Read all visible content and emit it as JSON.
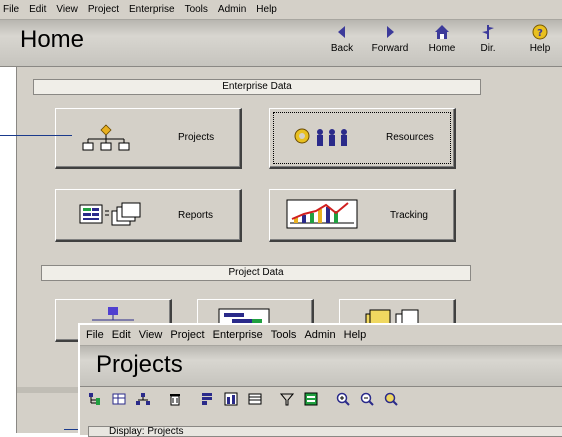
{
  "main_window": {
    "menu": [
      "File",
      "Edit",
      "View",
      "Project",
      "Enterprise",
      "Tools",
      "Admin",
      "Help"
    ],
    "title": "Home",
    "nav": [
      {
        "label": "Back",
        "icon": "back-arrow-icon"
      },
      {
        "label": "Forward",
        "icon": "forward-arrow-icon"
      },
      {
        "label": "Home",
        "icon": "home-icon"
      },
      {
        "label": "Dir.",
        "icon": "directory-icon"
      },
      {
        "label": "Help",
        "icon": "help-icon"
      }
    ],
    "enterprise_section": {
      "heading": "Enterprise Data",
      "tiles": [
        {
          "label": "Projects",
          "icon": "org-chart-icon"
        },
        {
          "label": "Resources",
          "icon": "people-icon"
        },
        {
          "label": "Reports",
          "icon": "report-pages-icon"
        },
        {
          "label": "Tracking",
          "icon": "tracking-chart-icon"
        }
      ]
    },
    "project_section": {
      "heading": "Project Data",
      "tiles": [
        {
          "icon": "wbs-icon"
        },
        {
          "icon": "gantt-icon"
        },
        {
          "icon": "documents-icon"
        }
      ]
    }
  },
  "overlay_window": {
    "menu": [
      "File",
      "Edit",
      "View",
      "Project",
      "Enterprise",
      "Tools",
      "Admin",
      "Help"
    ],
    "title": "Projects",
    "toolbar_icons": [
      "hierarchy-icon",
      "grid-view-icon",
      "org-icon",
      "trash-icon",
      "columns-icon",
      "bar-chart-icon",
      "table-icon",
      "filter-icon",
      "layout-icon",
      "zoom-in-icon",
      "zoom-out-icon",
      "zoom-fit-icon"
    ],
    "display_bar_text": "Display: Projects"
  },
  "colors": {
    "chrome": "#d4d0c8",
    "callout": "#1a3a8c",
    "nav_icon": "#3c3a9a"
  }
}
